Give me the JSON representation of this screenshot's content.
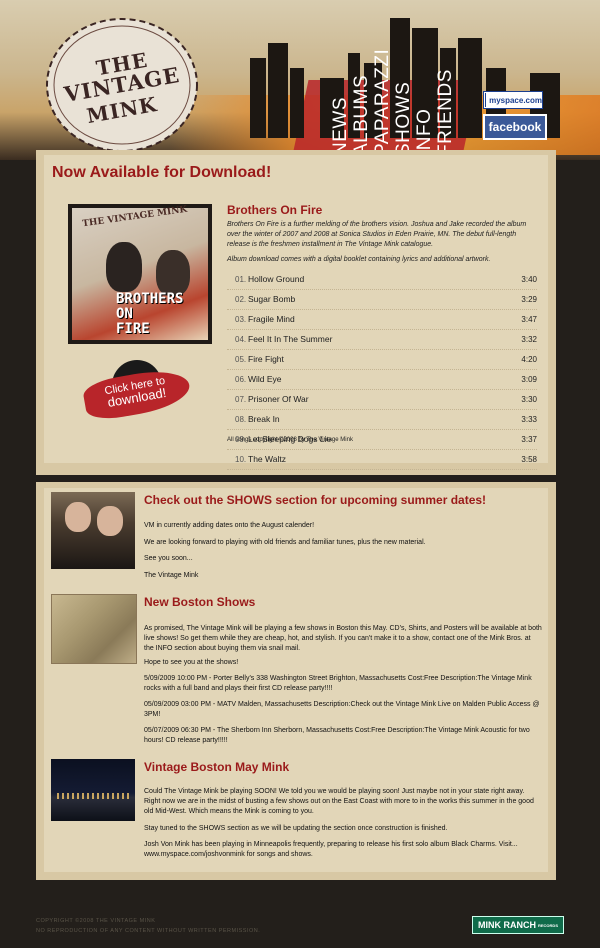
{
  "header": {
    "logo": {
      "line1": "THE",
      "line2": "VINTAGE",
      "line3": "MINK"
    },
    "nav": [
      {
        "label": "NEWS"
      },
      {
        "label": "ALBUMS"
      },
      {
        "label": "PAPARAZZI"
      },
      {
        "label": "SHOWS"
      },
      {
        "label": "INFO"
      },
      {
        "label": "FRIENDS"
      }
    ],
    "social": {
      "myspace": "myspace.com",
      "facebook": "facebook"
    }
  },
  "download_section": {
    "heading": "Now Available for Download!",
    "badge_text_1": "Click here to",
    "badge_text_2": "download!",
    "album": {
      "cover_band": "THE VINTAGE MINK",
      "cover_title_1": "BROTHERS",
      "cover_title_2": "ON",
      "cover_title_3": "FIRE",
      "title": "Brothers On Fire",
      "description": "Brothers On Fire is a further melding of the brothers vision. Joshua and Jake recorded the album over the winter of 2007 and 2008 at Sonica Studios in Eden Prairie, MN. The debut full-length release is the freshmen installment in The Vintage Mink catalogue.",
      "note": "Album download comes with a digital booklet containing lyrics and additional artwork.",
      "tracks": [
        {
          "num": "01.",
          "title": "Hollow Ground",
          "duration": "3:40"
        },
        {
          "num": "02.",
          "title": "Sugar Bomb",
          "duration": "3:29"
        },
        {
          "num": "03.",
          "title": "Fragile Mind",
          "duration": "3:47"
        },
        {
          "num": "04.",
          "title": "Feel It In The Summer",
          "duration": "3:32"
        },
        {
          "num": "05.",
          "title": "Fire Fight",
          "duration": "4:20"
        },
        {
          "num": "06.",
          "title": "Wild Eye",
          "duration": "3:09"
        },
        {
          "num": "07.",
          "title": "Prisoner Of War",
          "duration": "3:30"
        },
        {
          "num": "08.",
          "title": "Break In",
          "duration": "3:33"
        },
        {
          "num": "09.",
          "title": "Let Sleeping Dogs Lie",
          "duration": "3:37"
        },
        {
          "num": "10.",
          "title": "The Waltz",
          "duration": "3:58"
        }
      ],
      "copyright": "All songs copyright ©2008 by The Vintage Mink"
    }
  },
  "news": [
    {
      "title": "Check out the SHOWS section for upcoming summer dates!",
      "paragraphs": [
        "VM in currently adding dates onto the August calender!",
        "We are looking forward to playing with old friends and familiar tunes, plus the new material.",
        "See you soon...",
        "The Vintage Mink"
      ]
    },
    {
      "title": "New Boston Shows",
      "paragraphs": [
        "As promised, The Vintage Mink will be playing a few shows in Boston this May. CD's, Shirts, and Posters will be available at both live shows! So get them while they are cheap, hot, and stylish. If you can't make it to a show, contact one of the Mink Bros. at the INFO section about buying them via snail mail.",
        "Hope to see you at the shows!",
        "5/09/2009 10:00 PM - Porter Belly's 338 Washington Street Brighton, Massachusetts Cost:Free Description:The Vintage Mink rocks with a full band and plays their first CD release party!!!!",
        "05/09/2009 03:00 PM - MATV Malden, Massachusetts Description:Check out the Vintage Mink Live on Malden Public Access @ 3PM!",
        "05/07/2009 06:30 PM - The Sherborn Inn Sherborn, Massachusetts Cost:Free Description:The Vintage Mink Acoustic for two hours! CD release party!!!!!"
      ]
    },
    {
      "title": "Vintage Boston May Mink",
      "paragraphs": [
        "Could The Vintage Mink be playing SOON! We told you we would be playing soon! Just maybe not in your state right away. Right now we are in the midst of busting a few shows out on the East Coast with more to in the works this summer in the good old Mid-West. Which means the Mink is coming to you.",
        "Stay tuned to the SHOWS section as we will be updating the section once construction is finished.",
        "Josh Von Mink has been playing in Minneapolis frequently, preparing to release his first solo album Black Charms. Visit... www.myspace.com/joshvonmink for songs and shows."
      ]
    }
  ],
  "footer": {
    "line1": "COPYRIGHT ©2008 THE VINTAGE MINK",
    "line2": "NO REPRODUCTION OF ANY CONTENT WITHOUT WRITTEN PERMISSION.",
    "badge": "MINK RANCH",
    "badge_sub": "RECORDS"
  },
  "colors": {
    "accent_red": "#9a1a1a",
    "panel": "#e2d6b8",
    "background": "#231f1b"
  }
}
